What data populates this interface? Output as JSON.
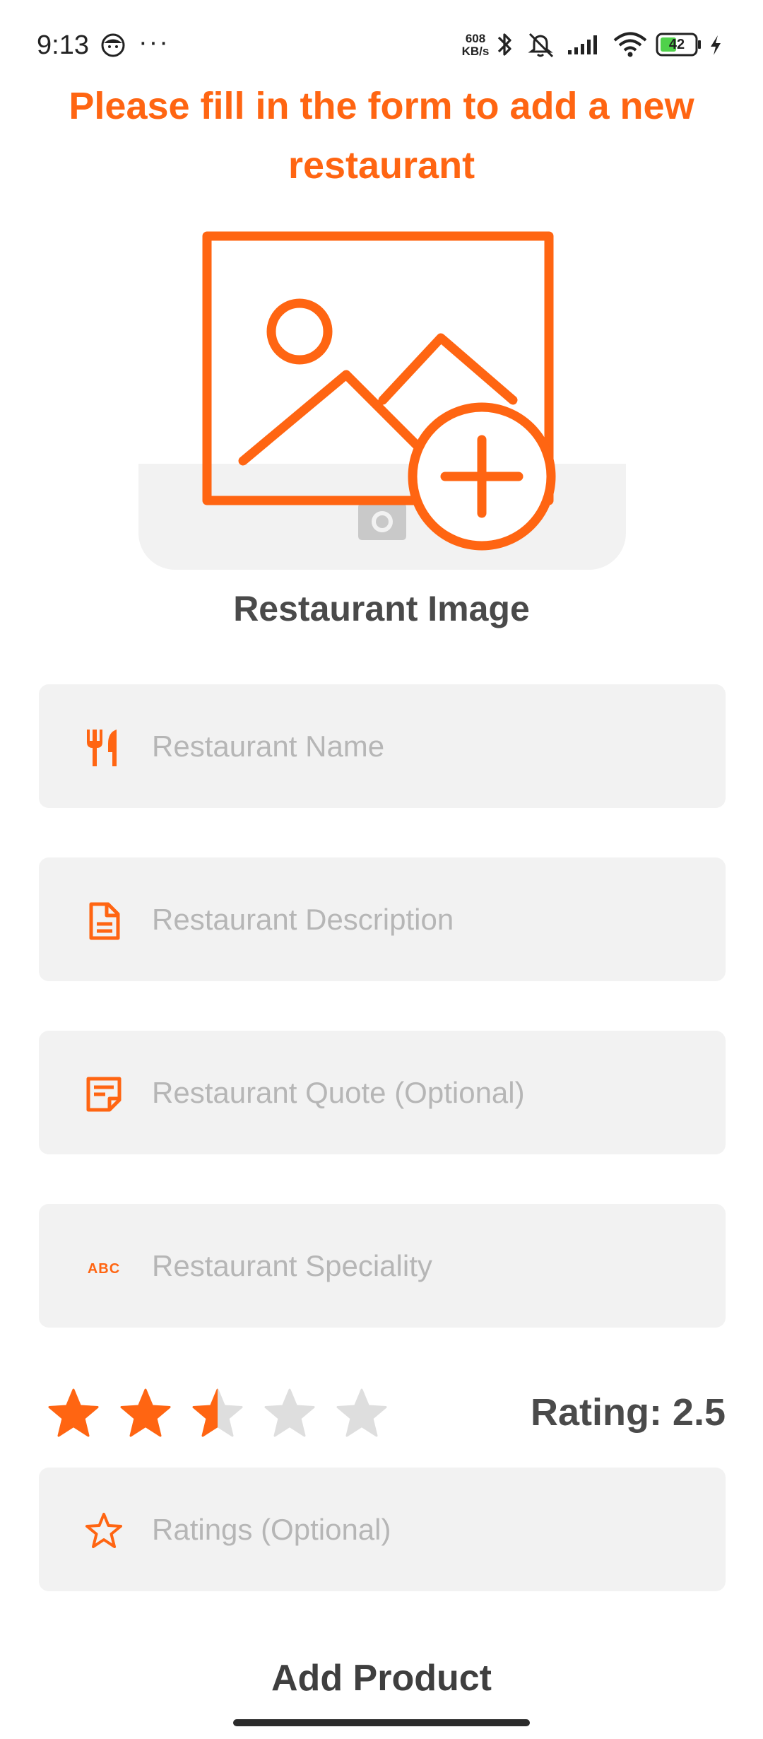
{
  "status_bar": {
    "time": "9:13",
    "more": "···",
    "net_speed_value": "608",
    "net_speed_unit": "KB/s",
    "battery": "42"
  },
  "header": {
    "title": "Please fill in the form to add a new restaurant"
  },
  "image_picker": {
    "label": "Restaurant Image"
  },
  "form": {
    "fields": [
      {
        "placeholder": "Restaurant Name",
        "value": "",
        "icon": "cutlery-icon"
      },
      {
        "placeholder": "Restaurant Description",
        "value": "",
        "icon": "document-icon"
      },
      {
        "placeholder": "Restaurant Quote (Optional)",
        "value": "",
        "icon": "note-icon"
      },
      {
        "placeholder": "Restaurant Speciality",
        "value": "",
        "icon": "abc-icon"
      }
    ],
    "ratings_field": {
      "placeholder": "Ratings (Optional)",
      "value": "",
      "icon": "star-outline-icon"
    }
  },
  "rating": {
    "value": 2.5,
    "max": 5,
    "label": "Rating: 2.5"
  },
  "actions": {
    "submit_label": "Add Product"
  },
  "colors": {
    "accent": "#ff6512",
    "field_bg": "#f2f2f2",
    "placeholder": "#b6b6b6",
    "star_empty": "#dedede",
    "text_dark": "#4a4a4a"
  }
}
